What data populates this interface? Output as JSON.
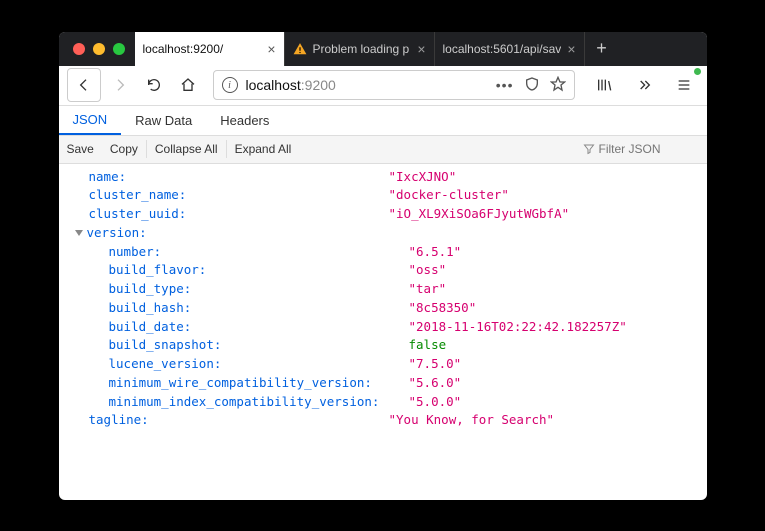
{
  "tabs": [
    {
      "label": "localhost:9200/",
      "active": true,
      "warn": false
    },
    {
      "label": "Problem loading p",
      "active": false,
      "warn": true
    },
    {
      "label": "localhost:5601/api/sav",
      "active": false,
      "warn": false
    }
  ],
  "url": {
    "host": "localhost",
    "rest": ":9200"
  },
  "sub_tabs": {
    "json": "JSON",
    "raw": "Raw Data",
    "headers": "Headers"
  },
  "toolbar": {
    "save": "Save",
    "copy": "Copy",
    "collapse": "Collapse All",
    "expand": "Expand All",
    "filter_placeholder": "Filter JSON"
  },
  "json": {
    "name": {
      "k": "name:",
      "v": "\"IxcXJNO\""
    },
    "cluster_name": {
      "k": "cluster_name:",
      "v": "\"docker-cluster\""
    },
    "cluster_uuid": {
      "k": "cluster_uuid:",
      "v": "\"iO_XL9XiSOa6FJyutWGbfA\""
    },
    "version_label": "version:",
    "version": {
      "number": {
        "k": "number:",
        "v": "\"6.5.1\""
      },
      "build_flavor": {
        "k": "build_flavor:",
        "v": "\"oss\""
      },
      "build_type": {
        "k": "build_type:",
        "v": "\"tar\""
      },
      "build_hash": {
        "k": "build_hash:",
        "v": "\"8c58350\""
      },
      "build_date": {
        "k": "build_date:",
        "v": "\"2018-11-16T02:22:42.182257Z\""
      },
      "build_snapshot": {
        "k": "build_snapshot:",
        "v": "false"
      },
      "lucene_version": {
        "k": "lucene_version:",
        "v": "\"7.5.0\""
      },
      "minimum_wire_compatibility_version": {
        "k": "minimum_wire_compatibility_version:",
        "v": "\"5.6.0\""
      },
      "minimum_index_compatibility_version": {
        "k": "minimum_index_compatibility_version:",
        "v": "\"5.0.0\""
      }
    },
    "tagline": {
      "k": "tagline:",
      "v": "\"You Know, for Search\""
    }
  }
}
